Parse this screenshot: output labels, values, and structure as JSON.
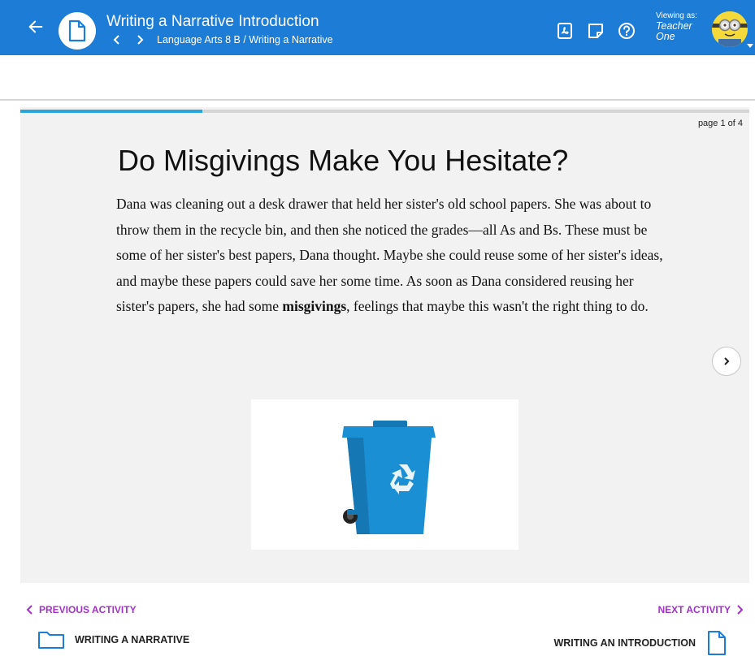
{
  "header": {
    "title": "Writing a Narrative Introduction",
    "breadcrumb": "Language Arts 8 B / Writing a Narrative",
    "viewing_label": "Viewing as:",
    "viewer_name": "Teacher One"
  },
  "slide": {
    "page_label": "page 1 of 4",
    "progress": 0.25,
    "title": "Do Misgivings Make You Hesitate?",
    "body_before": "Dana was cleaning out a desk drawer that held her sister's old school papers. She was about to throw them in the recycle bin, and then she noticed the grades—all As and Bs. These must be some of her sister's best papers, Dana thought. Maybe she could reuse some of her sister's ideas, and maybe these papers could save her some time. As soon as Dana considered reusing her sister's papers, she had some ",
    "body_bold": "misgivings",
    "body_after": ", feelings that maybe this wasn't the right thing to do."
  },
  "footer": {
    "prev_label": "PREVIOUS ACTIVITY",
    "prev_name": "WRITING A NARRATIVE",
    "next_label": "NEXT ACTIVITY",
    "next_name": "WRITING AN INTRODUCTION"
  },
  "colors": {
    "header_blue": "#1c7cd6",
    "progress_blue": "#29a6d9",
    "activity_purple": "#a431c7",
    "bin_blue": "#1a8fd4"
  },
  "icons": {
    "back": "arrow-left-icon",
    "document": "document-icon",
    "pdf": "pdf-icon",
    "note": "note-icon",
    "help": "help-circle-icon",
    "next_page": "chevron-right-icon",
    "folder": "folder-icon",
    "recycle_bin": "recycle-bin-image"
  }
}
